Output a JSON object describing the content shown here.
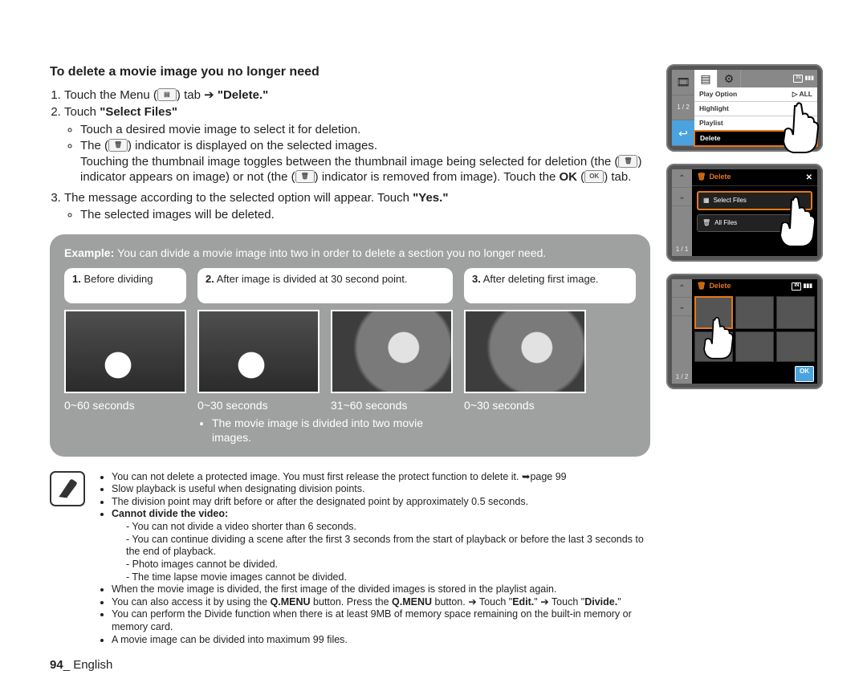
{
  "heading": "To delete a movie image you no longer need",
  "steps": {
    "s1_a": "Touch the Menu (",
    "s1_icon": "▤",
    "s1_b": ") tab ➔ ",
    "s1_c": "\"Delete.\"",
    "s2_a": "Touch ",
    "s2_b": "\"Select Files\"",
    "s2_bul1": "Touch a desired movie image to select it for deletion.",
    "s2_bul2_a": "The (",
    "s2_bul2_icon": "🗑",
    "s2_bul2_b": ") indicator is displayed on the selected images.",
    "s2_bul2_c": "Touching the thumbnail image toggles between the thumbnail image being selected for deletion (the (",
    "s2_bul2_d": ") indicator appears on image) or not (the (",
    "s2_bul2_e": ") indicator is removed from image). Touch the ",
    "s2_bul2_f": "OK",
    "s2_bul2_g": " (",
    "s2_bul2_ok": "OK",
    "s2_bul2_h": ") tab.",
    "s3_a": "The message according to the selected option will appear. Touch ",
    "s3_b": "\"Yes.\"",
    "s3_bul1": "The selected images will be deleted."
  },
  "example": {
    "lead_a": "Example: ",
    "lead_b": "You can divide a movie image into two in order to delete a section you no longer need.",
    "cap1": "Before dividing",
    "cap1_num": "1.",
    "cap2": "After image is divided at 30 second point.",
    "cap2_num": "2.",
    "cap3": "After deleting first image.",
    "cap3_num": "3.",
    "t1": "0~60 seconds",
    "t2a": "0~30 seconds",
    "t2b": "31~60 seconds",
    "t3": "0~30 seconds",
    "divnote": "The movie image is divided into two movie images."
  },
  "notes": {
    "n1": "You can not delete a protected image. You must first release the protect function to delete it. ➥page 99",
    "n2": "Slow playback is useful when designating division points.",
    "n3": "The division point may drift before or after the designated point by approximately 0.5 seconds.",
    "n4_h": "Cannot divide the video:",
    "n4a": "You can not divide a video shorter than 6 seconds.",
    "n4b": "You can continue dividing a scene after the first 3 seconds from the start of playback or before the last 3 seconds to the end of playback.",
    "n4c": "Photo images cannot be divided.",
    "n4d": "The time lapse movie images cannot be divided.",
    "n5": "When the movie image is divided, the first image of the divided images is stored in the playlist again.",
    "n6_a": "You can also access it by using the ",
    "n6_b": "Q.MENU",
    "n6_c": " button. Press the ",
    "n6_d": "Q.MENU",
    "n6_e": " button. ➔ Touch \"",
    "n6_f": "Edit.",
    "n6_g": "\" ➔ Touch \"",
    "n6_h": "Divide.",
    "n6_i": "\"",
    "n7": "You can perform the Divide function when there is at least 9MB of memory space remaining on the built-in memory or memory card.",
    "n8": "A movie image can be divided into maximum 99 files."
  },
  "footer": {
    "page": "94",
    "sep": "_ ",
    "lang": "English"
  },
  "device1": {
    "count": "1 / 2",
    "menu": [
      "Play Option",
      "Highlight",
      "Playlist",
      "Delete"
    ],
    "play_badge": "▷ ALL",
    "card_in": "IN"
  },
  "device2": {
    "title": "Delete",
    "count": "1 / 1",
    "opt_sel": "Select Files",
    "opt_all": "All Files"
  },
  "device3": {
    "title": "Delete",
    "count": "1 / 2",
    "ok": "OK",
    "card_in": "IN"
  }
}
